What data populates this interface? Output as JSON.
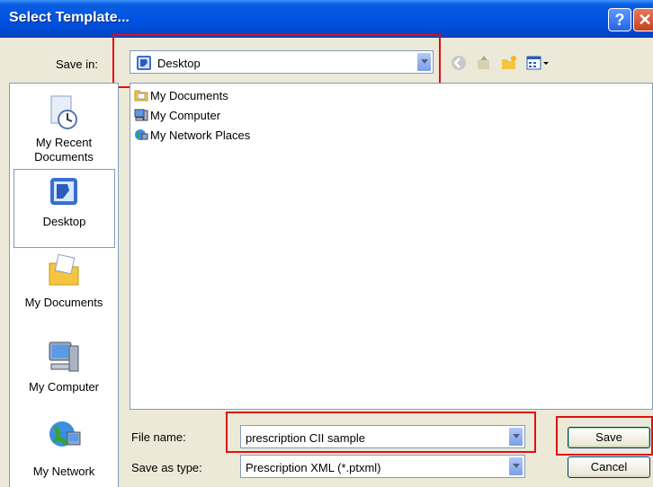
{
  "window": {
    "title": "Select Template..."
  },
  "save_in": {
    "label": "Save in:",
    "value": "Desktop"
  },
  "places": [
    {
      "name": "recent",
      "label": "My Recent Documents"
    },
    {
      "name": "desktop",
      "label": "Desktop"
    },
    {
      "name": "documents",
      "label": "My Documents"
    },
    {
      "name": "computer",
      "label": "My Computer"
    },
    {
      "name": "network",
      "label": "My Network"
    }
  ],
  "files": [
    {
      "name": "My Documents",
      "icon": "folder-icon"
    },
    {
      "name": "My Computer",
      "icon": "computer-icon"
    },
    {
      "name": "My Network Places",
      "icon": "network-icon"
    }
  ],
  "file_name": {
    "label": "File name:",
    "value": "prescription CII sample"
  },
  "save_type": {
    "label": "Save as type:",
    "value": "Prescription XML (*.ptxml)"
  },
  "buttons": {
    "save": "Save",
    "cancel": "Cancel"
  },
  "colors": {
    "titlebar": "#0054e3",
    "highlight": "#e01010",
    "face": "#ece9d8"
  }
}
